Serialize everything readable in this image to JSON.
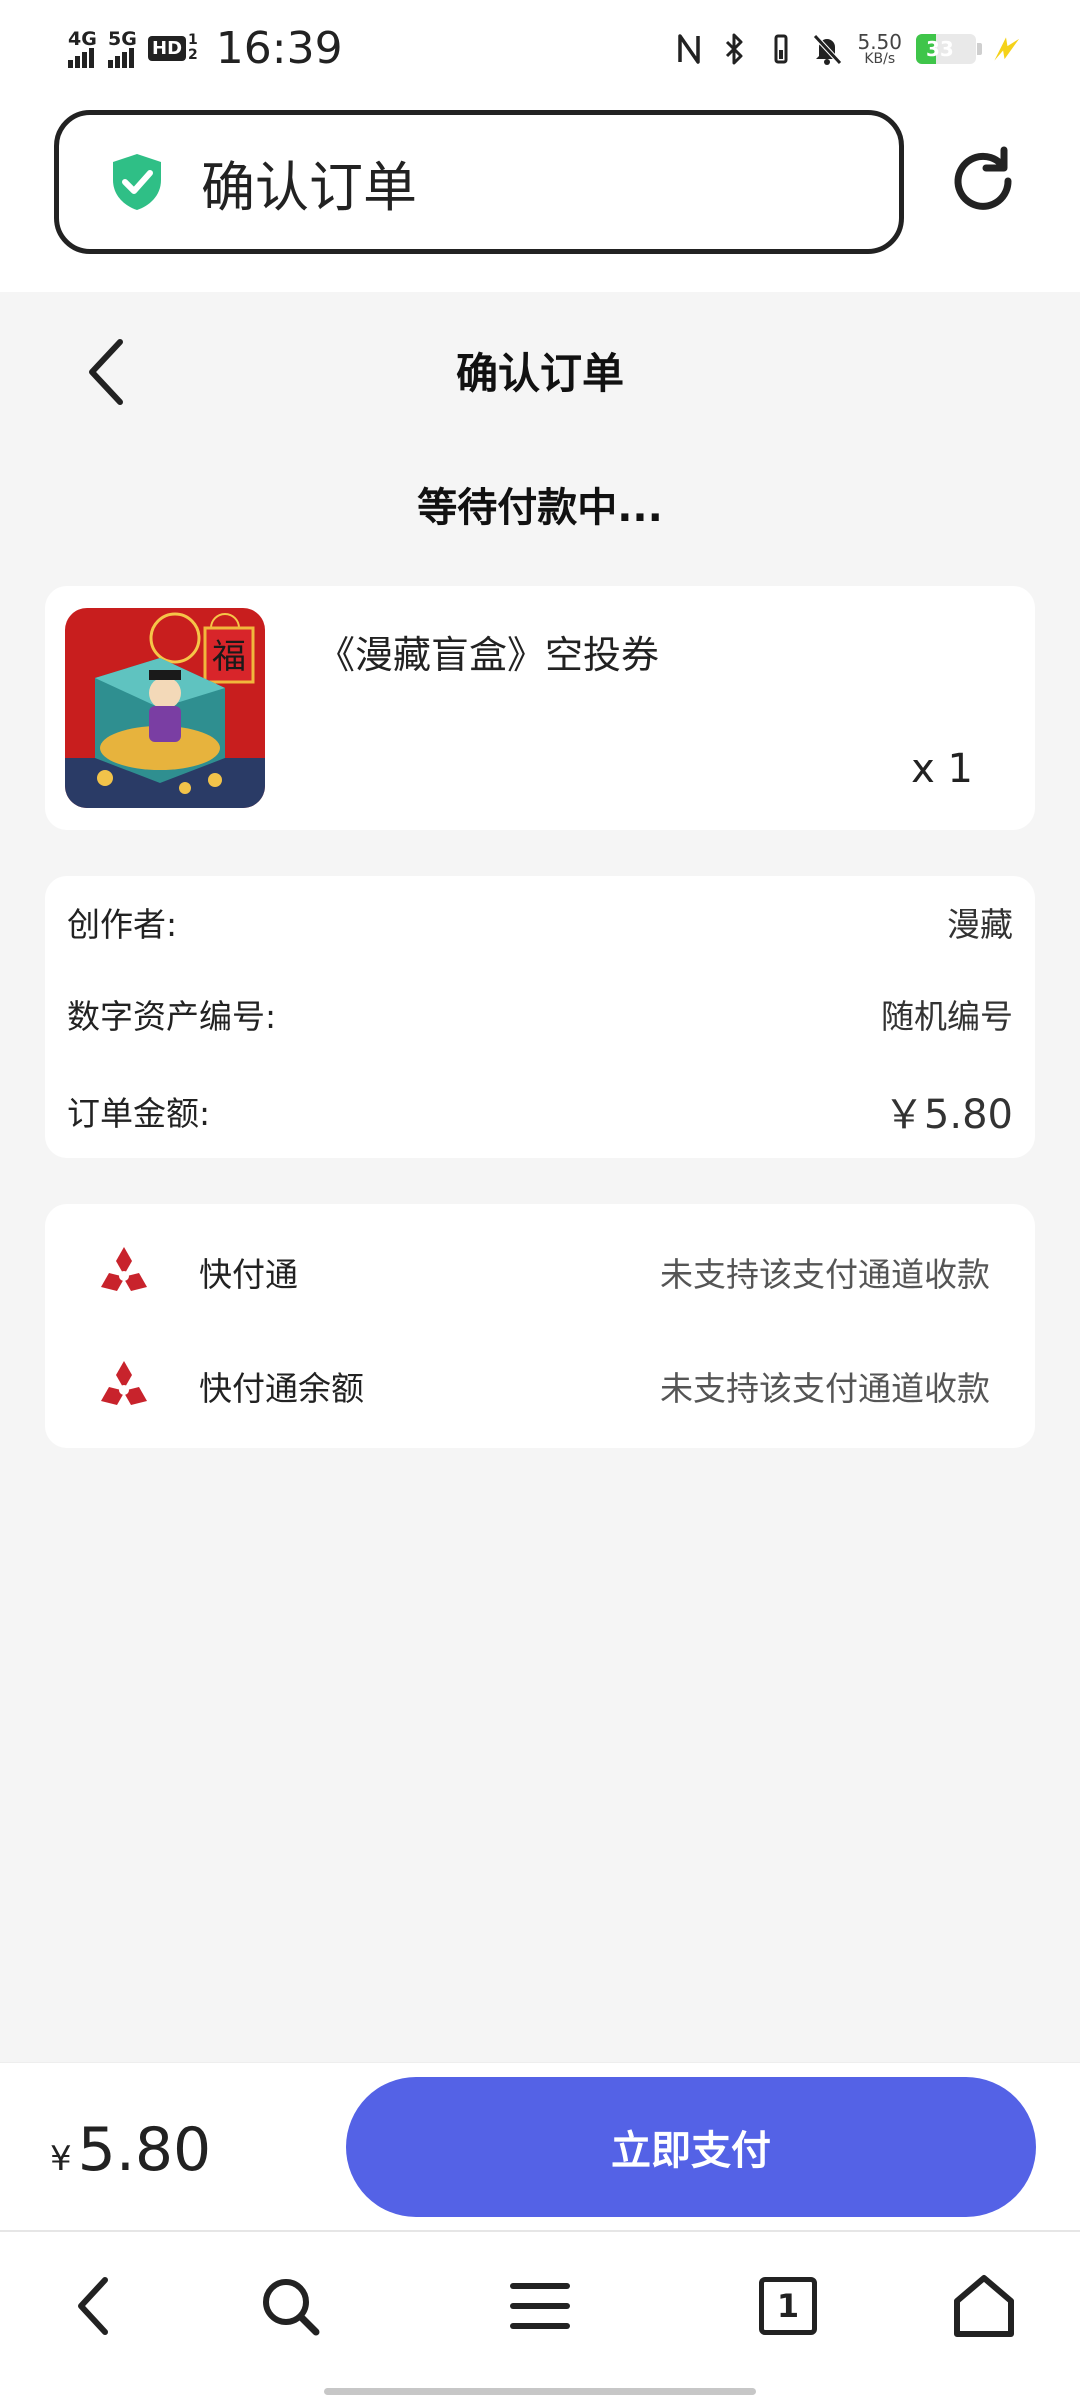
{
  "status_bar": {
    "network1": "4G",
    "network2": "5G",
    "hd_label": "HD",
    "hd_sub1": "1",
    "hd_sub2": "2",
    "time": "16:39",
    "speed_value": "5.50",
    "speed_unit": "KB/s",
    "battery_level": "33",
    "battery_color": "#3fc54a",
    "icons": [
      "nfc-icon",
      "bluetooth-icon",
      "vibrate-icon",
      "mute-icon",
      "battery-icon",
      "charging-icon"
    ]
  },
  "browser": {
    "url_title": "确认订单",
    "secure_icon": "shield-check-icon",
    "reload_icon": "reload-icon"
  },
  "header": {
    "title": "确认订单",
    "back_icon": "chevron-left-icon"
  },
  "status_text": "等待付款中...",
  "product": {
    "name": "《漫藏盲盒》空投券",
    "quantity": "x 1",
    "image_char": "福"
  },
  "info": {
    "rows": [
      {
        "label": "创作者:",
        "value": "漫藏"
      },
      {
        "label": "数字资产编号:",
        "value": "随机编号"
      },
      {
        "label": "订单金额:",
        "value": "￥5.80"
      }
    ]
  },
  "payment_methods": [
    {
      "name": "快付通",
      "status": "未支持该支付通道收款"
    },
    {
      "name": "快付通余额",
      "status": "未支持该支付通道收款"
    }
  ],
  "footer": {
    "currency": "¥",
    "amount": "5.80",
    "pay_button": "立即支付",
    "accent_color": "#5462e6"
  },
  "browser_nav": {
    "tab_count": "1",
    "icons": [
      "back-icon",
      "search-icon",
      "menu-icon",
      "tabs-icon",
      "home-icon"
    ]
  }
}
